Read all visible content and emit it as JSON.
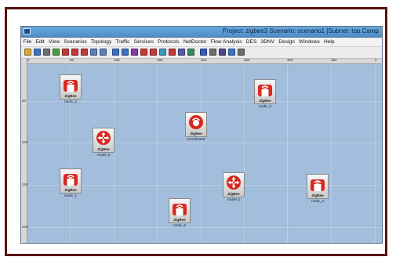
{
  "window": {
    "title": "Project: zigbee3 Scenario: scenario1  [Subnet: top.Camp"
  },
  "menu": [
    "File",
    "Edit",
    "View",
    "Scenarios",
    "Topology",
    "Traffic",
    "Services",
    "Protocols",
    "NetDoctor",
    "Flow Analysis",
    "DES",
    "3DNV",
    "Design",
    "Windows",
    "Help"
  ],
  "toolbar_icons": [
    "open-folder-icon",
    "save-icon",
    "print-icon",
    "import-icon",
    "delete-icon",
    "stop-icon",
    "pin-icon",
    "zoom-in-icon",
    "zoom-out-icon",
    "link-icon",
    "link-config-icon",
    "failure-icon",
    "node-icon",
    "tower-icon",
    "report-icon",
    "statistics-icon",
    "wand-icon",
    "grid-icon",
    "chart-icon",
    "table-icon",
    "settings-icon",
    "camera-icon",
    "document-icon"
  ],
  "rulers": {
    "x_ticks": [
      "0",
      "50",
      "100",
      "150",
      "200",
      "250",
      "300",
      "350",
      "4"
    ],
    "y_ticks": [
      "50",
      "100",
      "150",
      "200"
    ]
  },
  "node_badge": "ZigBee",
  "nodes": [
    {
      "id": "node_2",
      "label": "node_2",
      "kind": "end-device"
    },
    {
      "id": "node_3",
      "label": "node_3",
      "kind": "end-device"
    },
    {
      "id": "coordinator",
      "label": "coordinator",
      "kind": "coordinator"
    },
    {
      "id": "router_2",
      "label": "router 2",
      "kind": "router"
    },
    {
      "id": "node_1",
      "label": "node_1",
      "kind": "end-device"
    },
    {
      "id": "router_1",
      "label": "router 1",
      "kind": "router"
    },
    {
      "id": "node_4",
      "label": "node_4",
      "kind": "end-device"
    },
    {
      "id": "node_6",
      "label": "node_6",
      "kind": "end-device"
    }
  ],
  "colors": {
    "canvas": "#a3bddc",
    "node_red": "#d8281f",
    "frame": "#5a1210"
  }
}
